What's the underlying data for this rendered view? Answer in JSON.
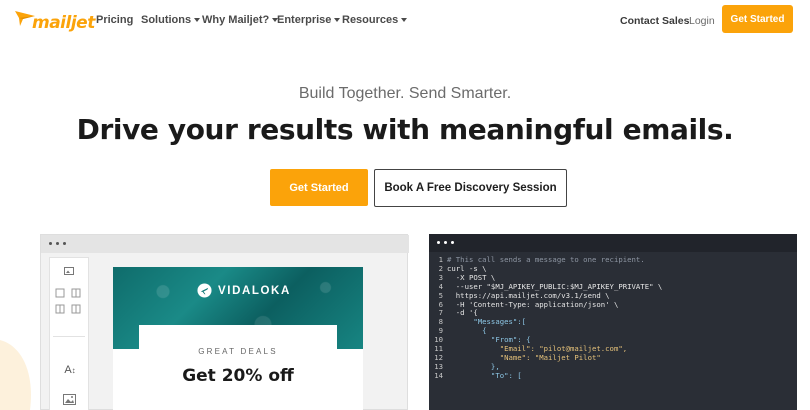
{
  "nav": {
    "logo_text": "mailjet",
    "items": [
      {
        "label": "Pricing",
        "dropdown": false
      },
      {
        "label": "Solutions",
        "dropdown": true
      },
      {
        "label": "Why Mailjet?",
        "dropdown": true
      },
      {
        "label": "Enterprise",
        "dropdown": true
      },
      {
        "label": "Resources",
        "dropdown": true
      }
    ],
    "contact": "Contact Sales",
    "login": "Login",
    "cta": "Get Started"
  },
  "hero": {
    "tagline": "Build Together. Send Smarter.",
    "headline": "Drive your results with meaningful emails.",
    "primary_button": "Get Started",
    "secondary_button": "Book A Free Discovery Session"
  },
  "editor_mock": {
    "brand": "VIDALOKA",
    "kicker": "GREAT DEALS",
    "title": "Get 20% off",
    "tools": [
      "image-block-icon",
      "columns-icon",
      "text-icon",
      "picture-icon"
    ]
  },
  "code_mock": {
    "lines": [
      {
        "n": "1",
        "text": "# This call sends a message to one recipient.",
        "type": "comment"
      },
      {
        "n": "2",
        "text": "curl -s \\",
        "type": "plain"
      },
      {
        "n": "3",
        "text": "  -X POST \\",
        "type": "plain"
      },
      {
        "n": "4",
        "text": "  --user \"$MJ_APIKEY_PUBLIC:$MJ_APIKEY_PRIVATE\" \\",
        "type": "plain"
      },
      {
        "n": "5",
        "text": "  https://api.mailjet.com/v3.1/send \\",
        "type": "plain"
      },
      {
        "n": "6",
        "text": "  -H 'Content-Type: application/json' \\",
        "type": "plain"
      },
      {
        "n": "7",
        "text": "  -d '{",
        "type": "plain"
      },
      {
        "n": "8",
        "text": "      \"Messages\":[",
        "type": "key"
      },
      {
        "n": "9",
        "text": "        {",
        "type": "key"
      },
      {
        "n": "10",
        "text": "          \"From\": {",
        "type": "key"
      },
      {
        "n": "11",
        "text": "            \"Email\": \"pilot@mailjet.com\",",
        "type": "str"
      },
      {
        "n": "12",
        "text": "            \"Name\": \"Mailjet Pilot\"",
        "type": "str"
      },
      {
        "n": "13",
        "text": "          },",
        "type": "key"
      },
      {
        "n": "14",
        "text": "          \"To\": [",
        "type": "key"
      }
    ]
  },
  "colors": {
    "brand_orange": "#fba30a",
    "code_bg": "#2a2e36",
    "banner_teal": "#0f6c6b"
  }
}
